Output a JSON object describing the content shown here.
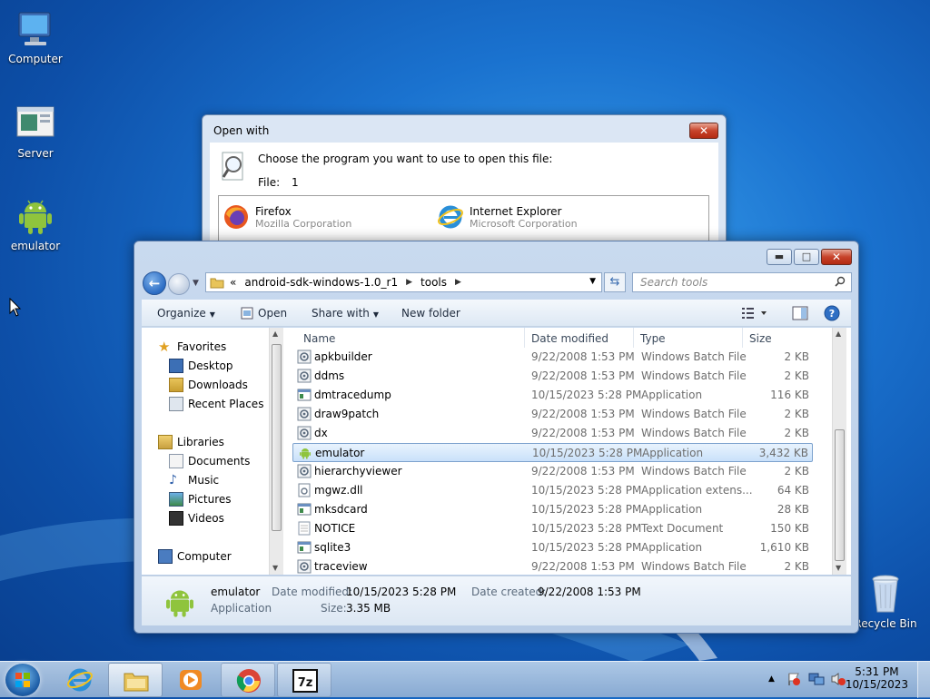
{
  "desktop": {
    "icons": [
      {
        "label": "Computer"
      },
      {
        "label": "Server"
      },
      {
        "label": "emulator"
      },
      {
        "label": "Recycle Bin"
      }
    ]
  },
  "open_with": {
    "title": "Open with",
    "close_glyph": "✕",
    "prompt": "Choose the program you want to use to open this file:",
    "file_label": "File:",
    "file_value": "1",
    "programs": [
      {
        "name": "Firefox",
        "vendor": "Mozilla Corporation",
        "icon": "firefox-icon"
      },
      {
        "name": "Internet Explorer",
        "vendor": "Microsoft Corporation",
        "icon": "internet-explorer-icon"
      }
    ]
  },
  "explorer": {
    "caption_buttons": {
      "minimize": "▬",
      "maximize": "□",
      "close": "✕"
    },
    "address": {
      "prefix": "«",
      "crumbs": [
        "android-sdk-windows-1.0_r1",
        "tools"
      ],
      "separator": "▶"
    },
    "search_placeholder": "Search tools",
    "commands": {
      "organize": "Organize",
      "open": "Open",
      "share_with": "Share with",
      "new_folder": "New folder"
    },
    "nav": {
      "favorites": "Favorites",
      "desktop": "Desktop",
      "downloads": "Downloads",
      "recent_places": "Recent Places",
      "libraries": "Libraries",
      "documents": "Documents",
      "music": "Music",
      "pictures": "Pictures",
      "videos": "Videos",
      "computer": "Computer"
    },
    "columns": {
      "name": "Name",
      "date": "Date modified",
      "type": "Type",
      "size": "Size"
    },
    "files": [
      {
        "name": "apkbuilder",
        "date": "9/22/2008 1:53 PM",
        "type": "Windows Batch File",
        "size": "2 KB",
        "icon": "batch"
      },
      {
        "name": "ddms",
        "date": "9/22/2008 1:53 PM",
        "type": "Windows Batch File",
        "size": "2 KB",
        "icon": "batch"
      },
      {
        "name": "dmtracedump",
        "date": "10/15/2023 5:28 PM",
        "type": "Application",
        "size": "116 KB",
        "icon": "app"
      },
      {
        "name": "draw9patch",
        "date": "9/22/2008 1:53 PM",
        "type": "Windows Batch File",
        "size": "2 KB",
        "icon": "batch"
      },
      {
        "name": "dx",
        "date": "9/22/2008 1:53 PM",
        "type": "Windows Batch File",
        "size": "2 KB",
        "icon": "batch"
      },
      {
        "name": "emulator",
        "date": "10/15/2023 5:28 PM",
        "type": "Application",
        "size": "3,432 KB",
        "icon": "android",
        "selected": true
      },
      {
        "name": "hierarchyviewer",
        "date": "9/22/2008 1:53 PM",
        "type": "Windows Batch File",
        "size": "2 KB",
        "icon": "batch"
      },
      {
        "name": "mgwz.dll",
        "date": "10/15/2023 5:28 PM",
        "type": "Application extens...",
        "size": "64 KB",
        "icon": "dll"
      },
      {
        "name": "mksdcard",
        "date": "10/15/2023 5:28 PM",
        "type": "Application",
        "size": "28 KB",
        "icon": "app"
      },
      {
        "name": "NOTICE",
        "date": "10/15/2023 5:28 PM",
        "type": "Text Document",
        "size": "150 KB",
        "icon": "text"
      },
      {
        "name": "sqlite3",
        "date": "10/15/2023 5:28 PM",
        "type": "Application",
        "size": "1,610 KB",
        "icon": "app"
      },
      {
        "name": "traceview",
        "date": "9/22/2008 1:53 PM",
        "type": "Windows Batch File",
        "size": "2 KB",
        "icon": "batch"
      }
    ],
    "details": {
      "name": "emulator",
      "type": "Application",
      "modified_label": "Date modified:",
      "modified_value": "10/15/2023 5:28 PM",
      "created_label": "Date created:",
      "created_value": "9/22/2008 1:53 PM",
      "size_label": "Size:",
      "size_value": "3.35 MB"
    }
  },
  "taskbar": {
    "apps": [
      "internet-explorer",
      "windows-explorer",
      "media-player",
      "chrome",
      "7-zip"
    ],
    "seven_zip_label": "7z",
    "tray_arrow": "▲",
    "time": "5:31 PM",
    "date": "10/15/2023"
  }
}
